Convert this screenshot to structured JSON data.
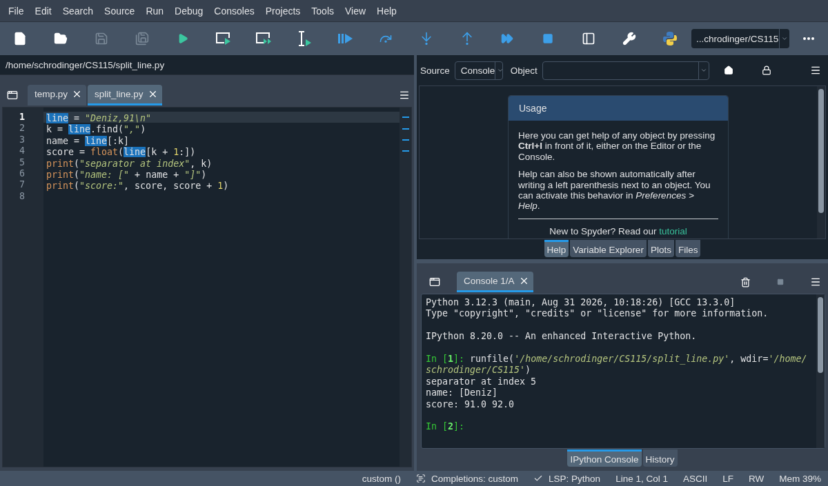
{
  "menu": [
    "File",
    "Edit",
    "Search",
    "Source",
    "Run",
    "Debug",
    "Consoles",
    "Projects",
    "Tools",
    "View",
    "Help"
  ],
  "toolbar": [
    {
      "kind": "new-file",
      "disabled": false
    },
    {
      "kind": "open",
      "disabled": false
    },
    {
      "kind": "save",
      "disabled": true
    },
    {
      "kind": "save-all",
      "disabled": true
    },
    {
      "kind": "run",
      "disabled": false
    },
    {
      "kind": "run-cell",
      "disabled": false
    },
    {
      "kind": "run-cell-advance",
      "disabled": false
    },
    {
      "kind": "run-selection",
      "disabled": false
    },
    {
      "kind": "debug",
      "disabled": false
    },
    {
      "kind": "step-over",
      "disabled": false
    },
    {
      "kind": "step-into",
      "disabled": false
    },
    {
      "kind": "step-out",
      "disabled": false
    },
    {
      "kind": "continue",
      "disabled": false
    },
    {
      "kind": "stop",
      "disabled": false
    },
    {
      "kind": "maximize",
      "disabled": false
    },
    {
      "kind": "preferences",
      "disabled": false
    },
    {
      "kind": "python-path",
      "disabled": false
    }
  ],
  "working_dir": "...chrodinger/CS115",
  "editor": {
    "path": "/home/schrodinger/CS115/split_line.py",
    "tabs": [
      {
        "label": "temp.py",
        "selected": false
      },
      {
        "label": "split_line.py",
        "selected": true
      }
    ],
    "lines": [
      {
        "number": "1",
        "current": true,
        "tokens": [
          {
            "text": "line",
            "kind": "occurrence"
          },
          {
            "text": " = ",
            "kind": "plain"
          },
          {
            "text": "\"Deniz,91\\n\"",
            "kind": "string"
          }
        ]
      },
      {
        "number": "2",
        "current": false,
        "tokens": [
          {
            "text": "k = ",
            "kind": "plain"
          },
          {
            "text": "line",
            "kind": "occurrence"
          },
          {
            "text": ".find(",
            "kind": "plain"
          },
          {
            "text": "\",\"",
            "kind": "string"
          },
          {
            "text": ")",
            "kind": "plain"
          }
        ]
      },
      {
        "number": "3",
        "current": false,
        "tokens": [
          {
            "text": "name = ",
            "kind": "plain"
          },
          {
            "text": "line",
            "kind": "occurrence"
          },
          {
            "text": "[:k]",
            "kind": "plain"
          }
        ]
      },
      {
        "number": "4",
        "current": false,
        "tokens": [
          {
            "text": "score = ",
            "kind": "plain"
          },
          {
            "text": "float",
            "kind": "builtin"
          },
          {
            "text": "(",
            "kind": "plain"
          },
          {
            "text": "line",
            "kind": "occurrence"
          },
          {
            "text": "[k + ",
            "kind": "plain"
          },
          {
            "text": "1",
            "kind": "number"
          },
          {
            "text": ":])",
            "kind": "plain"
          }
        ]
      },
      {
        "number": "5",
        "current": false,
        "tokens": [
          {
            "text": "print",
            "kind": "builtin"
          },
          {
            "text": "(",
            "kind": "plain"
          },
          {
            "text": "\"separator at index\"",
            "kind": "string"
          },
          {
            "text": ", k)",
            "kind": "plain"
          }
        ]
      },
      {
        "number": "6",
        "current": false,
        "tokens": [
          {
            "text": "print",
            "kind": "builtin"
          },
          {
            "text": "(",
            "kind": "plain"
          },
          {
            "text": "\"name: [\"",
            "kind": "string"
          },
          {
            "text": " + name + ",
            "kind": "plain"
          },
          {
            "text": "\"]\"",
            "kind": "string"
          },
          {
            "text": ")",
            "kind": "plain"
          }
        ]
      },
      {
        "number": "7",
        "current": false,
        "tokens": [
          {
            "text": "print",
            "kind": "builtin"
          },
          {
            "text": "(",
            "kind": "plain"
          },
          {
            "text": "\"score:\"",
            "kind": "string"
          },
          {
            "text": ", score, score + ",
            "kind": "plain"
          },
          {
            "text": "1",
            "kind": "number"
          },
          {
            "text": ")",
            "kind": "plain"
          }
        ]
      },
      {
        "number": "8",
        "current": false
      }
    ]
  },
  "help": {
    "source_label": "Source",
    "source_value": "Console",
    "object_label": "Object",
    "card": {
      "title": "Usage",
      "paragraphs": [
        "Here you can get help of any object by pressing **Ctrl+I** in front of it, either on the Editor or the Console.",
        "Help can also be shown automatically after writing a left parenthesis next to an object. You can activate this behavior in *Preferences > Help*."
      ],
      "footer": "New to Spyder? Read our",
      "link": "tutorial"
    },
    "tabs": [
      {
        "label": "Help",
        "selected": true
      },
      {
        "label": "Variable Explorer",
        "selected": false
      },
      {
        "label": "Plots",
        "selected": false
      },
      {
        "label": "Files",
        "selected": false
      }
    ]
  },
  "console": {
    "tabs": [
      {
        "label": "Console 1/A",
        "selected": true
      }
    ],
    "stop_disabled": true,
    "lines": [
      {
        "space_before": false,
        "segments": [
          {
            "text": "Python 3.12.3 (main, Aug 31 2026, 10:18:26) [GCC 13.3.0]",
            "kind": "plain"
          }
        ]
      },
      {
        "space_before": false,
        "segments": [
          {
            "text": "Type \"copyright\", \"credits\" or \"license\" for more information.",
            "kind": "plain"
          }
        ]
      },
      {
        "space_before": true,
        "segments": [
          {
            "text": "IPython 8.20.0 -- An enhanced Interactive Python.",
            "kind": "plain"
          }
        ]
      },
      {
        "space_before": true,
        "segments": [
          {
            "text": "In [",
            "kind": "prompt"
          },
          {
            "text": "1",
            "kind": "prompt-number"
          },
          {
            "text": "]: ",
            "kind": "prompt"
          },
          {
            "text": "runfile(",
            "kind": "plain"
          },
          {
            "text": "'/home/schrodinger/CS115/split_line.py'",
            "kind": "string"
          },
          {
            "text": ", wdir=",
            "kind": "plain"
          },
          {
            "text": "'/home/",
            "kind": "string"
          }
        ]
      },
      {
        "space_before": false,
        "segments": [
          {
            "text": "schrodinger/CS115'",
            "kind": "string"
          },
          {
            "text": ")",
            "kind": "plain"
          }
        ]
      },
      {
        "space_before": false,
        "segments": [
          {
            "text": "separator at index 5",
            "kind": "plain"
          }
        ]
      },
      {
        "space_before": false,
        "segments": [
          {
            "text": "name: [Deniz]",
            "kind": "plain"
          }
        ]
      },
      {
        "space_before": false,
        "segments": [
          {
            "text": "score: 91.0 92.0",
            "kind": "plain"
          }
        ]
      },
      {
        "space_before": true,
        "segments": [
          {
            "text": "In [",
            "kind": "prompt"
          },
          {
            "text": "2",
            "kind": "prompt-number"
          },
          {
            "text": "]:",
            "kind": "prompt"
          }
        ]
      }
    ],
    "pane_tabs": [
      {
        "label": "IPython Console",
        "selected": true
      },
      {
        "label": "History",
        "selected": false
      }
    ]
  },
  "status_bar": [
    {
      "kind": "text",
      "text": "custom ()"
    },
    {
      "kind": "completions",
      "text": "Completions: custom"
    },
    {
      "kind": "lsp",
      "text": "LSP: Python"
    },
    {
      "kind": "text",
      "text": "Line 1, Col 1"
    },
    {
      "kind": "text",
      "text": "ASCII"
    },
    {
      "kind": "text",
      "text": "LF"
    },
    {
      "kind": "text",
      "text": "RW"
    },
    {
      "kind": "text",
      "text": "Mem 39%"
    }
  ]
}
